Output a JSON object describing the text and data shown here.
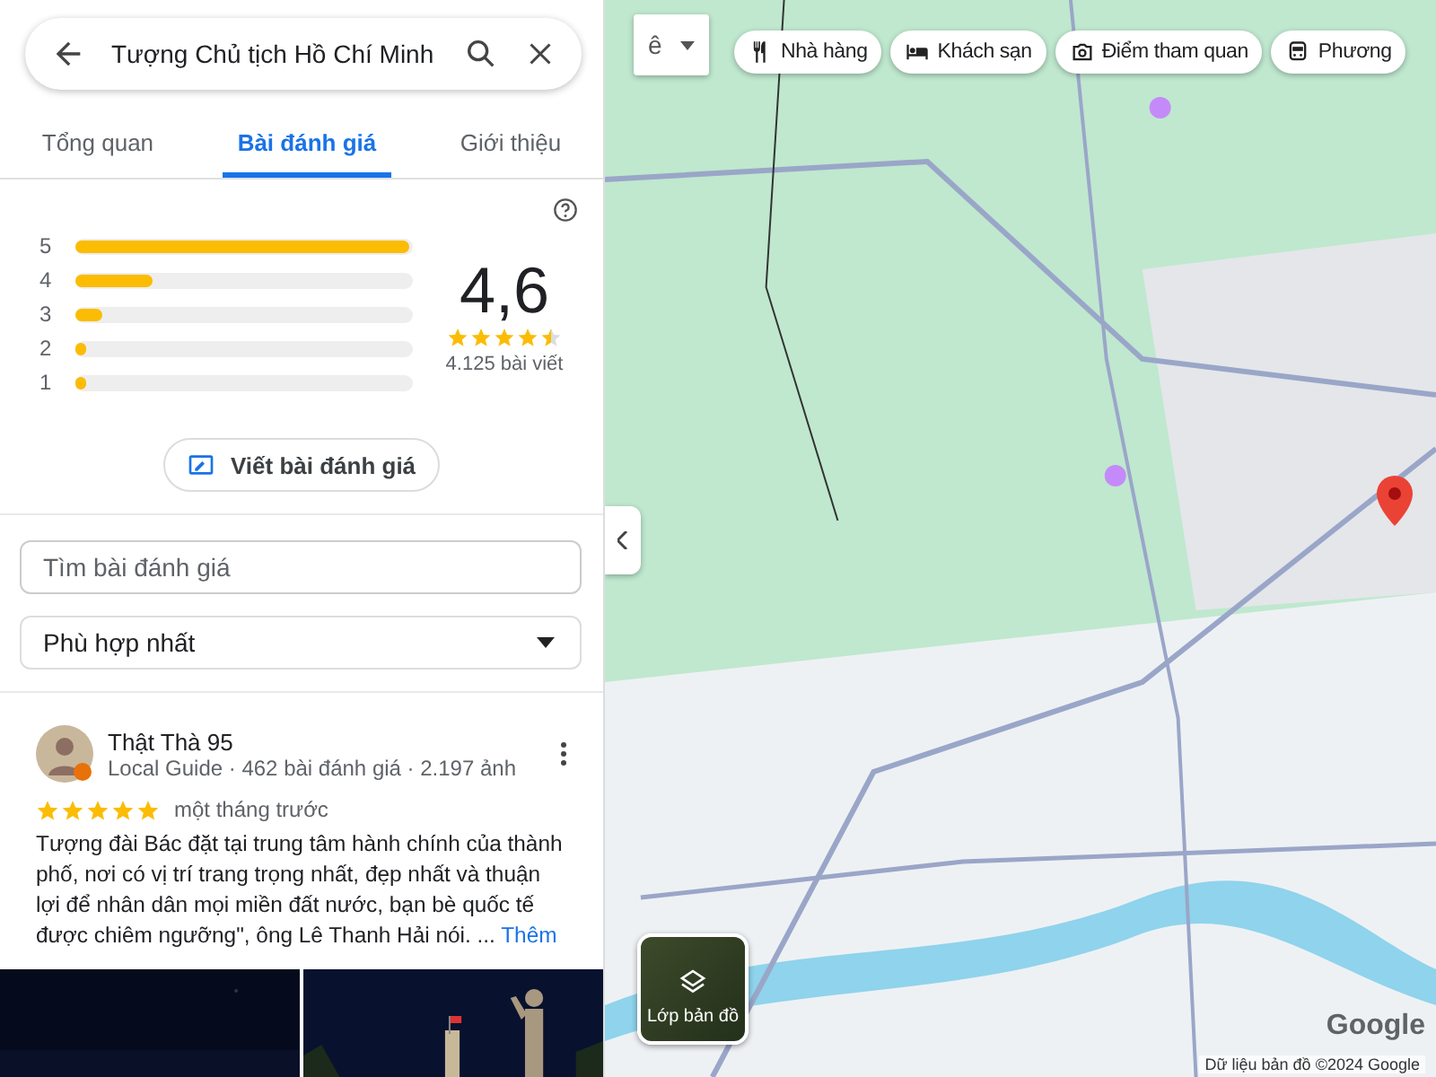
{
  "search": {
    "value": "Tượng Chủ tịch Hồ Chí Minh"
  },
  "tabs": [
    {
      "label": "Tổng quan",
      "selected": false
    },
    {
      "label": "Bài đánh giá",
      "selected": true
    },
    {
      "label": "Giới thiệu",
      "selected": false
    }
  ],
  "rating": {
    "average": "4,6",
    "stars": 4.5,
    "count": "4.125 bài viết",
    "bars": [
      {
        "label": "5",
        "level": 1.0
      },
      {
        "label": "4",
        "level": 0.23
      },
      {
        "label": "3",
        "level": 0.08
      },
      {
        "label": "2",
        "level": 0.01
      },
      {
        "label": "1",
        "level": 0.02
      }
    ]
  },
  "write_review_button": "Viết bài đánh giá",
  "review_search": {
    "placeholder": "Tìm bài đánh giá"
  },
  "sort": {
    "value": "Phù hợp nhất"
  },
  "reviews": [
    {
      "name": "Thật Thà 95",
      "meta": "Local Guide · 462 bài đánh giá · 2.197 ảnh",
      "stars": 5,
      "time": "một tháng trước",
      "text": "Tượng đài Bác đặt tại trung tâm hành chính của thành phố, nơi có vị trí trang trọng nhất, đẹp nhất và thuận lợi để nhân dân mọi miền đất nước, bạn bè quốc tế được chiêm ngưỡng\", ông Lê Thanh Hải nói. ...",
      "more": "Thêm"
    }
  ],
  "map": {
    "input_tool": "ê",
    "chips": [
      {
        "label": "Nhà hàng"
      },
      {
        "label": "Khách sạn"
      },
      {
        "label": "Điểm tham quan"
      },
      {
        "label": "Phương"
      }
    ],
    "layers_button": "Lớp bản đồ",
    "logo": "Google",
    "attribution": "Dữ liệu bản đồ ©2024 Google"
  }
}
